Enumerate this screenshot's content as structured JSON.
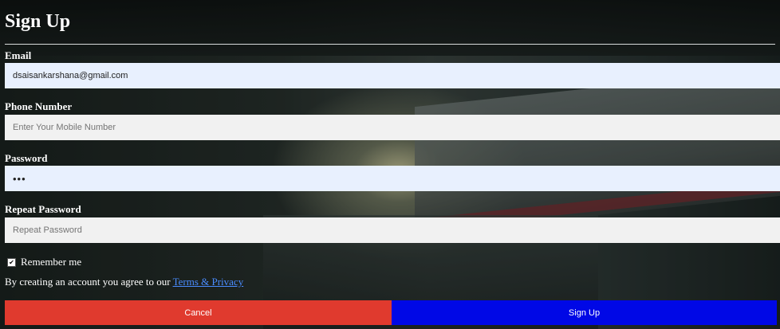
{
  "form": {
    "title": "Sign Up",
    "email": {
      "label": "Email",
      "value": "dsaisankarshana@gmail.com"
    },
    "phone": {
      "label": "Phone Number",
      "placeholder": "Enter Your Mobile Number"
    },
    "password": {
      "label": "Password",
      "value": "•••"
    },
    "repeat_password": {
      "label": "Repeat Password",
      "placeholder": "Repeat Password"
    },
    "remember": {
      "label": "Remember me",
      "checked": true,
      "check_glyph": "✔"
    },
    "terms": {
      "prefix": "By creating an account you agree to our ",
      "link": "Terms & Privacy"
    },
    "buttons": {
      "cancel": "Cancel",
      "signup": "Sign Up"
    }
  },
  "colors": {
    "cancel_bg": "#e03a2e",
    "signup_bg": "#0008e6",
    "autofill_bg": "#e8f0fe",
    "input_bg": "#f1f1f1",
    "link": "#4a8cff"
  }
}
